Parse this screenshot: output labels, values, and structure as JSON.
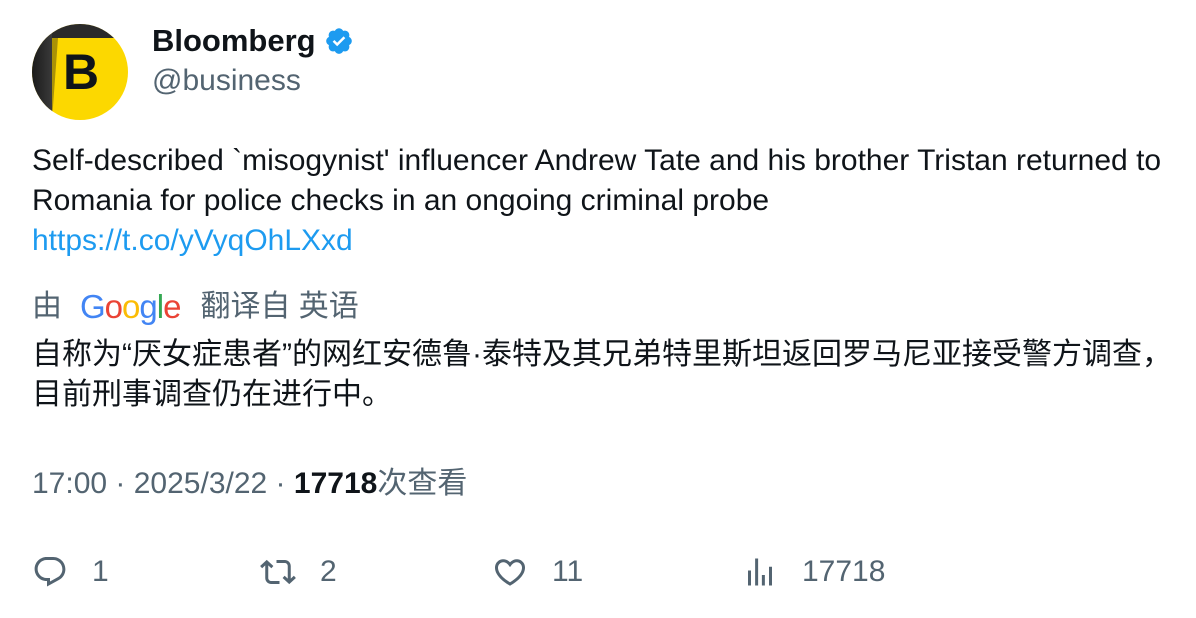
{
  "author": {
    "avatar_letter": "B",
    "name": "Bloomberg",
    "handle": "@business",
    "verified": true
  },
  "tweet": {
    "text": "Self-described `misogynist' influencer Andrew Tate and his brother Tristan returned to Romania for police checks in an ongoing criminal probe",
    "link": "https://t.co/yVyqOhLXxd"
  },
  "translation": {
    "prefix": "由",
    "provider": "Google",
    "suffix": "翻译自 英语",
    "text": "自称为“厌女症患者”的网红安德鲁·泰特及其兄弟特里斯坦返回罗马尼亚接受警方调查，目前刑事调查仍在进行中。"
  },
  "meta": {
    "time": "17:00",
    "sep1": " · ",
    "date": "2025/3/22",
    "sep2": " · ",
    "views": "17718",
    "views_label": "次查看"
  },
  "actions": {
    "replies": "1",
    "retweets": "2",
    "likes": "11",
    "views": "17718"
  },
  "colors": {
    "text": "#0f1419",
    "secondary": "#536471",
    "link": "#1d9bf0",
    "brand": "#fcd800"
  }
}
